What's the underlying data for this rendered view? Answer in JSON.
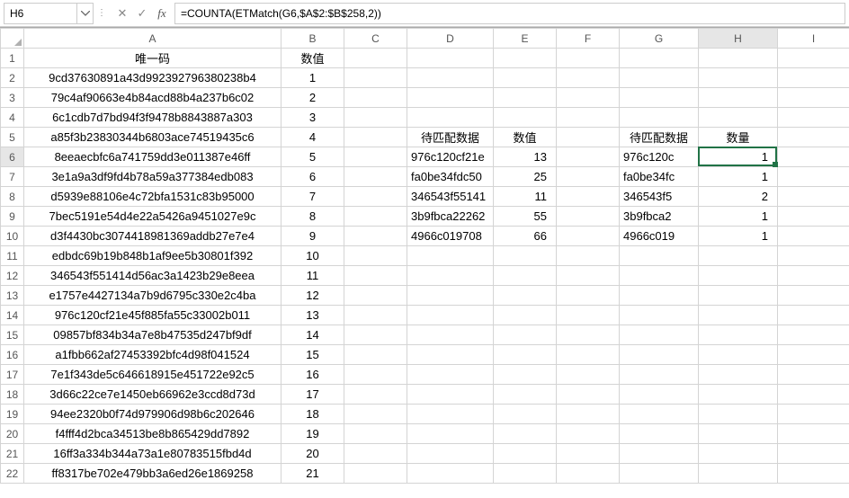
{
  "formula_bar": {
    "cell_ref": "H6",
    "formula": "=COUNTA(ETMatch(G6,$A$2:$B$258,2))"
  },
  "columns": {
    "A": "A",
    "B": "B",
    "C": "C",
    "D": "D",
    "E": "E",
    "F": "F",
    "G": "G",
    "H": "H",
    "I": "I"
  },
  "headers": {
    "A1": "唯一码",
    "B1": "数值",
    "D5": "待匹配数据",
    "E5": "数值",
    "G5": "待匹配数据",
    "H5": "数量"
  },
  "rows": [
    {
      "n": 1
    },
    {
      "n": 2,
      "A": "9cd37630891a43d992392796380238b4",
      "B": "1"
    },
    {
      "n": 3,
      "A": "79c4af90663e4b84acd88b4a237b6c02",
      "B": "2"
    },
    {
      "n": 4,
      "A": "6c1cdb7d7bd94f3f9478b8843887a303",
      "B": "3"
    },
    {
      "n": 5,
      "A": "a85f3b23830344b6803ace74519435c6",
      "B": "4"
    },
    {
      "n": 6,
      "A": "8eeaecbfc6a741759dd3e011387e46ff",
      "B": "5",
      "D": "976c120cf21e",
      "E": "13",
      "G": "976c120c",
      "H": "1"
    },
    {
      "n": 7,
      "A": "3e1a9a3df9fd4b78a59a377384edb083",
      "B": "6",
      "D": "fa0be34fdc50",
      "E": "25",
      "G": "fa0be34fc",
      "H": "1"
    },
    {
      "n": 8,
      "A": "d5939e88106e4c72bfa1531c83b95000",
      "B": "7",
      "D": "346543f55141",
      "E": "11",
      "G": "346543f5",
      "H": "2"
    },
    {
      "n": 9,
      "A": "7bec5191e54d4e22a5426a9451027e9c",
      "B": "8",
      "D": "3b9fbca22262",
      "E": "55",
      "G": "3b9fbca2",
      "H": "1"
    },
    {
      "n": 10,
      "A": "d3f4430bc3074418981369addb27e7e4",
      "B": "9",
      "D": "4966c019708",
      "E": "66",
      "G": "4966c019",
      "H": "1"
    },
    {
      "n": 11,
      "A": "edbdc69b19b848b1af9ee5b30801f392",
      "B": "10"
    },
    {
      "n": 12,
      "A": "346543f551414d56ac3a1423b29e8eea",
      "B": "11"
    },
    {
      "n": 13,
      "A": "e1757e4427134a7b9d6795c330e2c4ba",
      "B": "12"
    },
    {
      "n": 14,
      "A": "976c120cf21e45f885fa55c33002b011",
      "B": "13"
    },
    {
      "n": 15,
      "A": "09857bf834b34a7e8b47535d247bf9df",
      "B": "14"
    },
    {
      "n": 16,
      "A": "a1fbb662af27453392bfc4d98f041524",
      "B": "15"
    },
    {
      "n": 17,
      "A": "7e1f343de5c646618915e451722e92c5",
      "B": "16"
    },
    {
      "n": 18,
      "A": "3d66c22ce7e1450eb66962e3ccd8d73d",
      "B": "17"
    },
    {
      "n": 19,
      "A": "94ee2320b0f74d979906d98b6c202646",
      "B": "18"
    },
    {
      "n": 20,
      "A": "f4fff4d2bca34513be8b865429dd7892",
      "B": "19"
    },
    {
      "n": 21,
      "A": "16ff3a334b344a73a1e80783515fbd4d",
      "B": "20"
    },
    {
      "n": 22,
      "A": "ff8317be702e479bb3a6ed26e1869258",
      "B": "21"
    }
  ],
  "active_cell": {
    "row": 6,
    "col": "H"
  }
}
